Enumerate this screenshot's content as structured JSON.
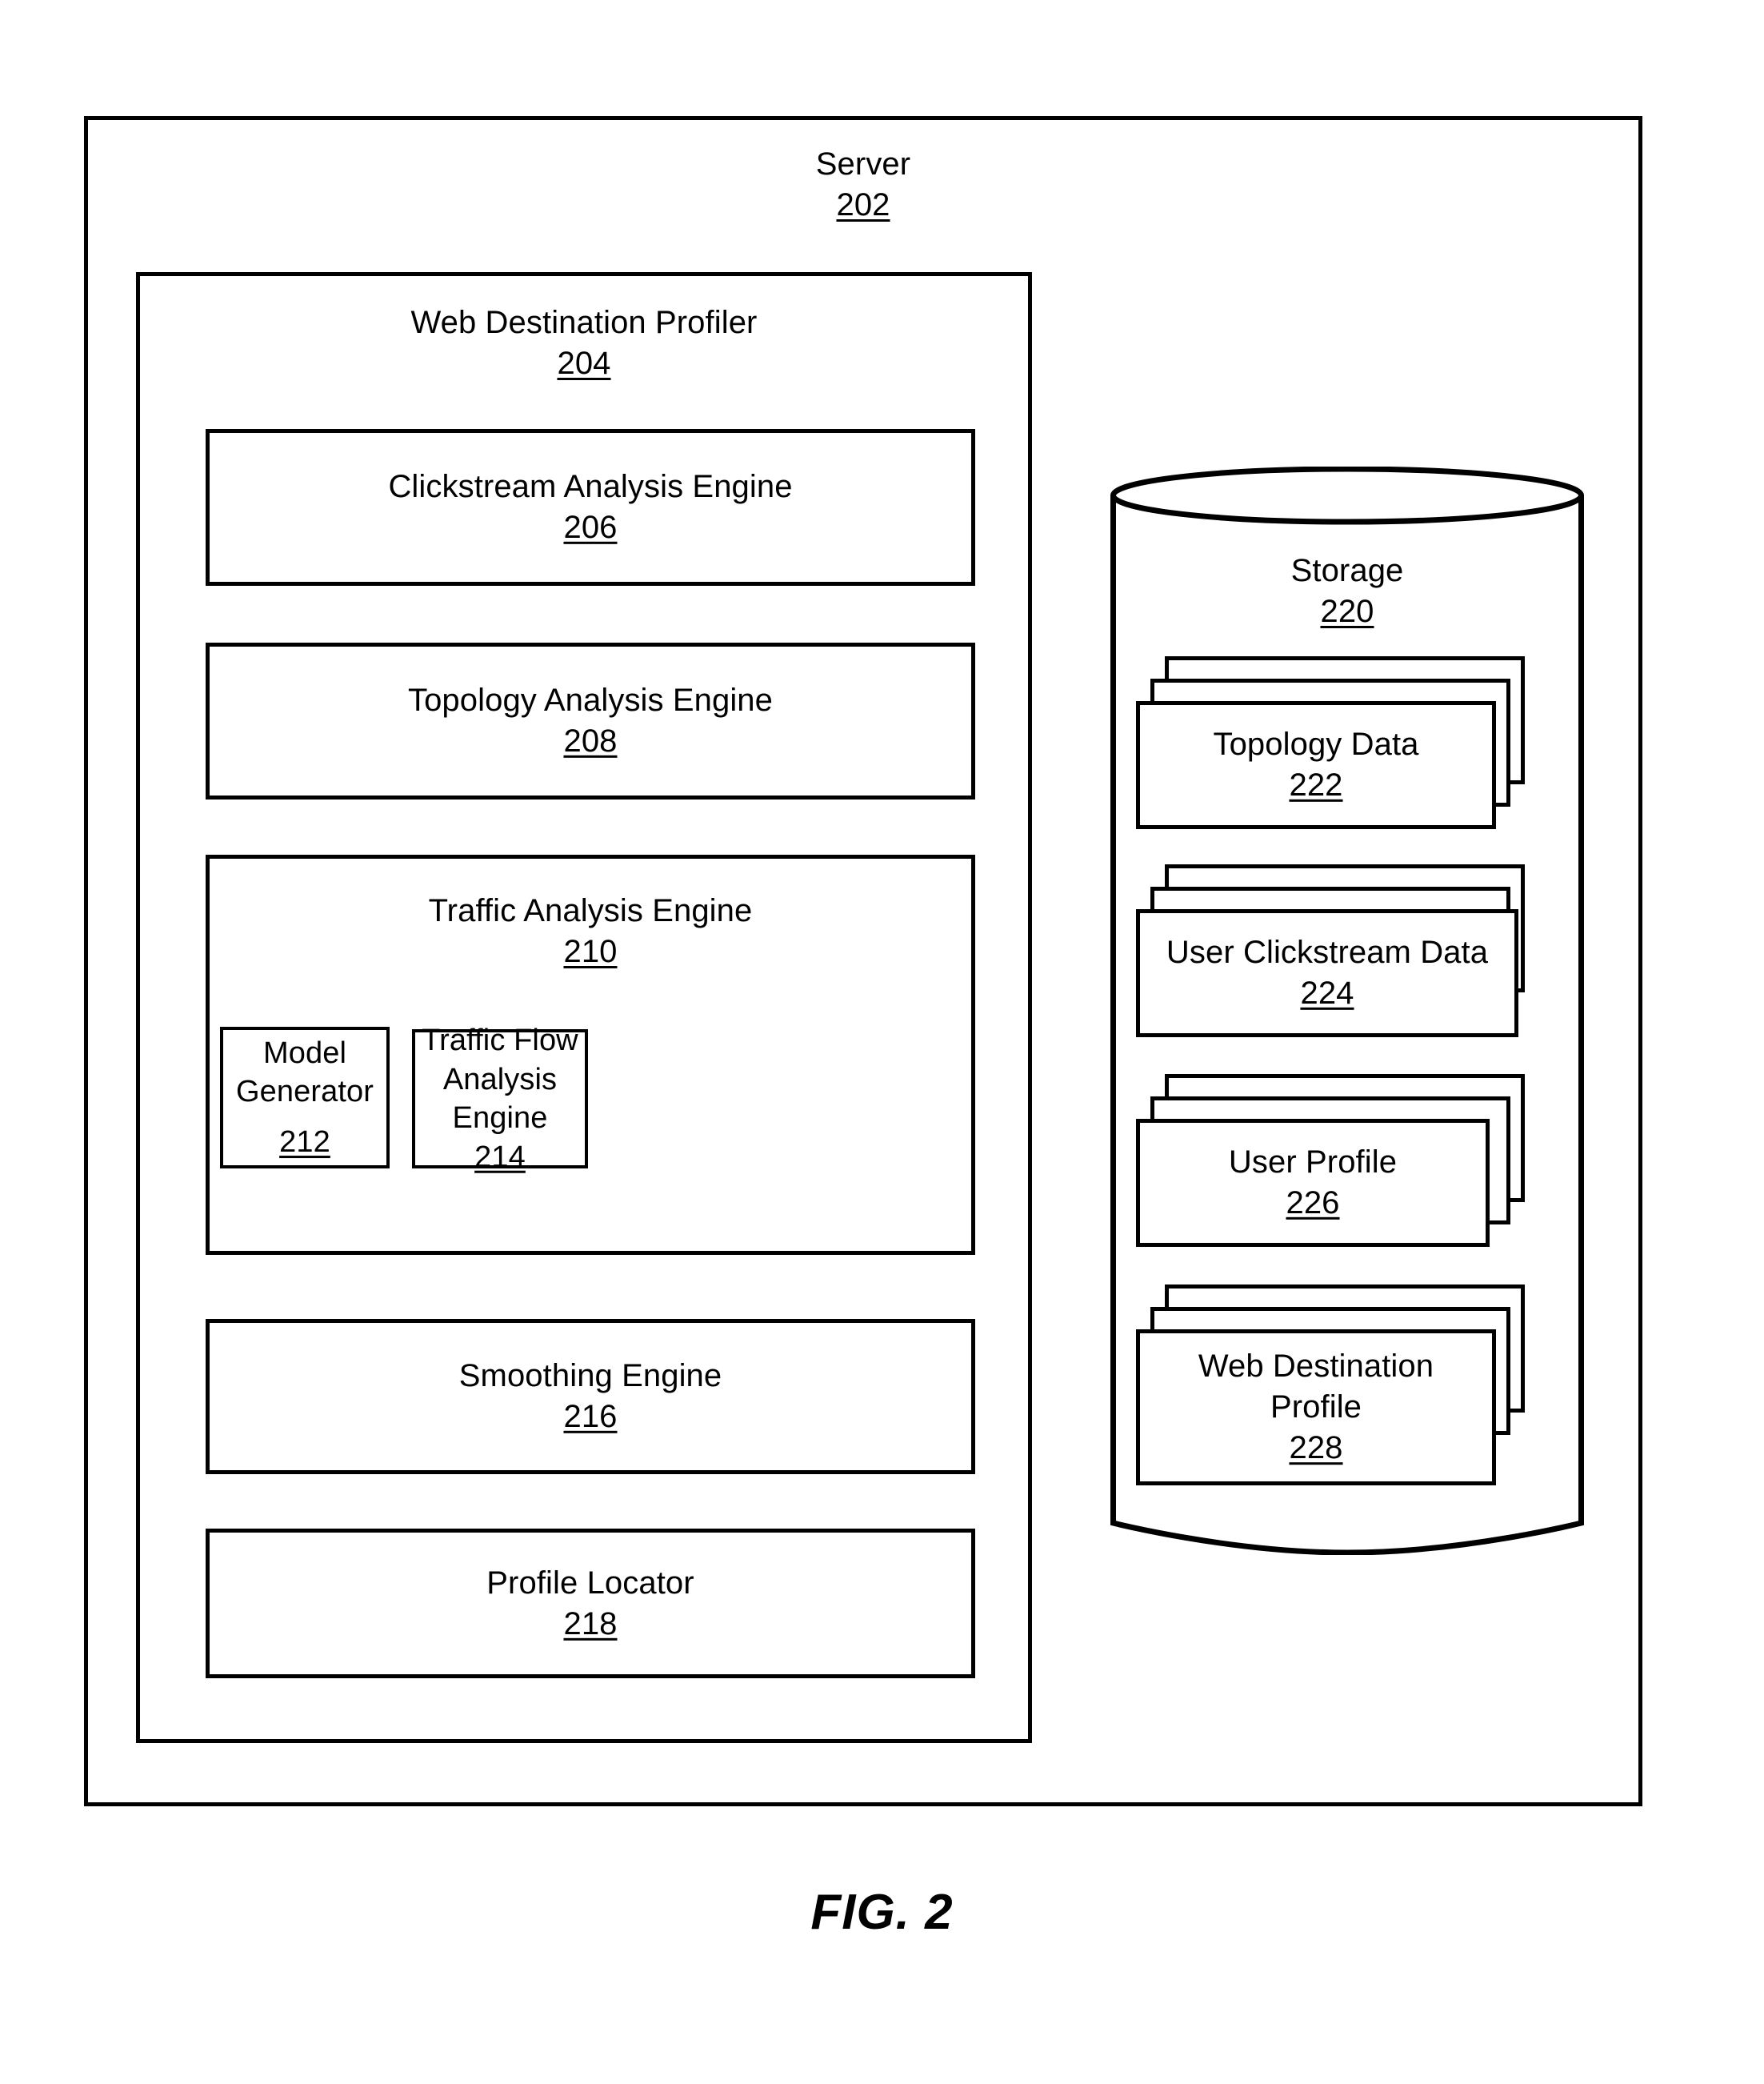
{
  "figure": {
    "caption": "FIG. 2"
  },
  "server": {
    "title": "Server",
    "ref": "202"
  },
  "profiler": {
    "title": "Web Destination Profiler",
    "ref": "204",
    "engines": [
      {
        "title": "Clickstream Analysis Engine",
        "ref": "206"
      },
      {
        "title": "Topology Analysis Engine",
        "ref": "208"
      },
      {
        "title": "Traffic Analysis Engine",
        "ref": "210"
      },
      {
        "title": "Smoothing Engine",
        "ref": "216"
      },
      {
        "title": "Profile Locator",
        "ref": "218"
      }
    ],
    "traffic_sub_engines": [
      {
        "title": "Model Generator",
        "ref": "212"
      },
      {
        "title_line1": "Traffic Flow",
        "title_line2": "Analysis Engine",
        "ref": "214"
      }
    ]
  },
  "storage": {
    "title": "Storage",
    "ref": "220",
    "cards": [
      {
        "title": "Topology Data",
        "ref": "222"
      },
      {
        "title": "User Clickstream Data",
        "ref": "224"
      },
      {
        "title": "User Profile",
        "ref": "226"
      },
      {
        "title_line1": "Web Destination",
        "title_line2": "Profile",
        "ref": "228"
      }
    ]
  },
  "colors": {
    "stroke": "#000000",
    "background": "#ffffff"
  }
}
